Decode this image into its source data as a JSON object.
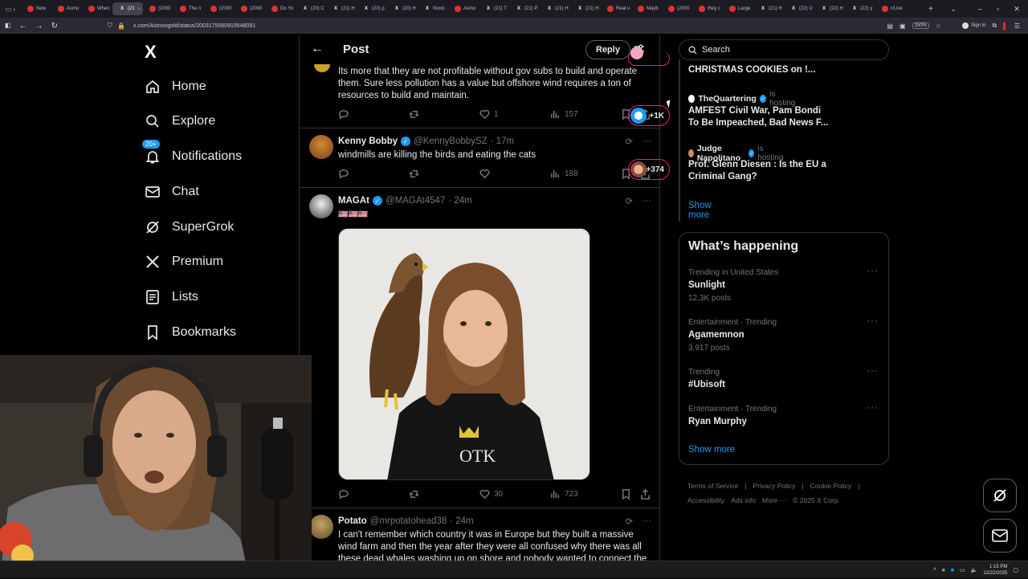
{
  "browser": {
    "tabs": [
      {
        "label": "New",
        "fav": "red"
      },
      {
        "label": "Asmo",
        "fav": "red"
      },
      {
        "label": "When",
        "fav": "red"
      },
      {
        "label": "(21",
        "fav": "x",
        "active": true
      },
      {
        "label": "(2000",
        "fav": "red"
      },
      {
        "label": "The n",
        "fav": "red"
      },
      {
        "label": "(2000",
        "fav": "red"
      },
      {
        "label": "(2000",
        "fav": "red"
      },
      {
        "label": "Do Yo",
        "fav": "red"
      },
      {
        "label": "(20) C",
        "fav": "x"
      },
      {
        "label": "(21) H",
        "fav": "x"
      },
      {
        "label": "(20) p",
        "fav": "x"
      },
      {
        "label": "(20) H",
        "fav": "x"
      },
      {
        "label": "Noxic",
        "fav": "x"
      },
      {
        "label": "Asmo",
        "fav": "red"
      },
      {
        "label": "(21) T",
        "fav": "x"
      },
      {
        "label": "(21) P",
        "fav": "x"
      },
      {
        "label": "(21) H",
        "fav": "x"
      },
      {
        "label": "(21) H",
        "fav": "x"
      },
      {
        "label": "Real u",
        "fav": "red"
      },
      {
        "label": "Mayb",
        "fav": "red"
      },
      {
        "label": "(2000",
        "fav": "red"
      },
      {
        "label": "they c",
        "fav": "red"
      },
      {
        "label": "Large",
        "fav": "red"
      },
      {
        "label": "(21) H",
        "fav": "x"
      },
      {
        "label": "(22) U",
        "fav": "x"
      },
      {
        "label": "(22) H",
        "fav": "x"
      },
      {
        "label": "(22) y",
        "fav": "x"
      },
      {
        "label": "r/Live",
        "fav": "red"
      }
    ],
    "url": "x.com/Asmongold/status/2003175560919548091",
    "zoom": "150%",
    "signin": "Sign in"
  },
  "nav": {
    "logo": "X",
    "items": [
      {
        "label": "Home",
        "icon": "home-icon"
      },
      {
        "label": "Explore",
        "icon": "search-icon"
      },
      {
        "label": "Notifications",
        "icon": "bell-icon",
        "badge": "20+"
      },
      {
        "label": "Chat",
        "icon": "mail-icon"
      },
      {
        "label": "SuperGrok",
        "icon": "grok-icon"
      },
      {
        "label": "Premium",
        "icon": "x-icon"
      },
      {
        "label": "Lists",
        "icon": "list-icon"
      },
      {
        "label": "Bookmarks",
        "icon": "bookmark-icon"
      }
    ]
  },
  "post": {
    "title": "Post",
    "reply": "Reply",
    "first_tweet": {
      "text": "Its more that they are not profitable without gov subs to build and operate them. Sure less pollution has a value but offshore wind requires a ton of resources to build and maintain.",
      "likes": "1",
      "views": "157"
    },
    "tweets": [
      {
        "name": "Kenny Bobby",
        "handle": "@KennyBobbySZ",
        "time": "· 17m",
        "text": "windmills are killing the birds and eating the cats",
        "likes": "",
        "views": "188"
      },
      {
        "name": "MAGAt",
        "handle": "@MAGAt4547",
        "time": "· 24m",
        "text": "🇺🇸🇺🇸🇺🇸",
        "likes": "30",
        "views": "723",
        "image_text": "OTK"
      },
      {
        "name": "Potato",
        "handle": "@mrpotatohead38",
        "time": "· 24m",
        "text": "I can't remember which country it was in Europe but they built a massive wind farm and then the year after they were all confused why there was all these dead whales washing up on shore and nobody wanted to connect the"
      }
    ]
  },
  "sidebar": {
    "search_placeholder": "Search",
    "spaces": {
      "top_title": "CHRISTMAS COOKIES on !...",
      "items": [
        {
          "host": "TheQuartering",
          "is_hosting": "is hosting",
          "title": "AMFEST Civil War, Pam Bondi To Be Impeached, Bad News F...",
          "count": "+1K"
        },
        {
          "host": "Judge Napolitano",
          "is_hosting": "is hosting",
          "title": "Prof. Glenn Diesen : Is the EU a Criminal Gang?",
          "count": "+374"
        }
      ],
      "show_more": "Show more"
    },
    "happening": {
      "title": "What’s happening",
      "trends": [
        {
          "meta": "Trending in United States",
          "name": "Sunlight",
          "count": "12.3K posts"
        },
        {
          "meta": "Entertainment · Trending",
          "name": "Agamemnon",
          "count": "3,917 posts"
        },
        {
          "meta": "Trending",
          "name": "#Ubisoft",
          "count": ""
        },
        {
          "meta": "Entertainment · Trending",
          "name": "Ryan Murphy",
          "count": ""
        }
      ],
      "show_more": "Show more"
    },
    "footer": [
      "Terms of Service",
      "|",
      "Privacy Policy",
      "|",
      "Cookie Policy",
      "|",
      "Accessibility",
      "Ads info",
      "More ···",
      "© 2025 X Corp."
    ]
  },
  "taskbar": {
    "time": "1:15 PM",
    "date": "12/22/2025"
  }
}
